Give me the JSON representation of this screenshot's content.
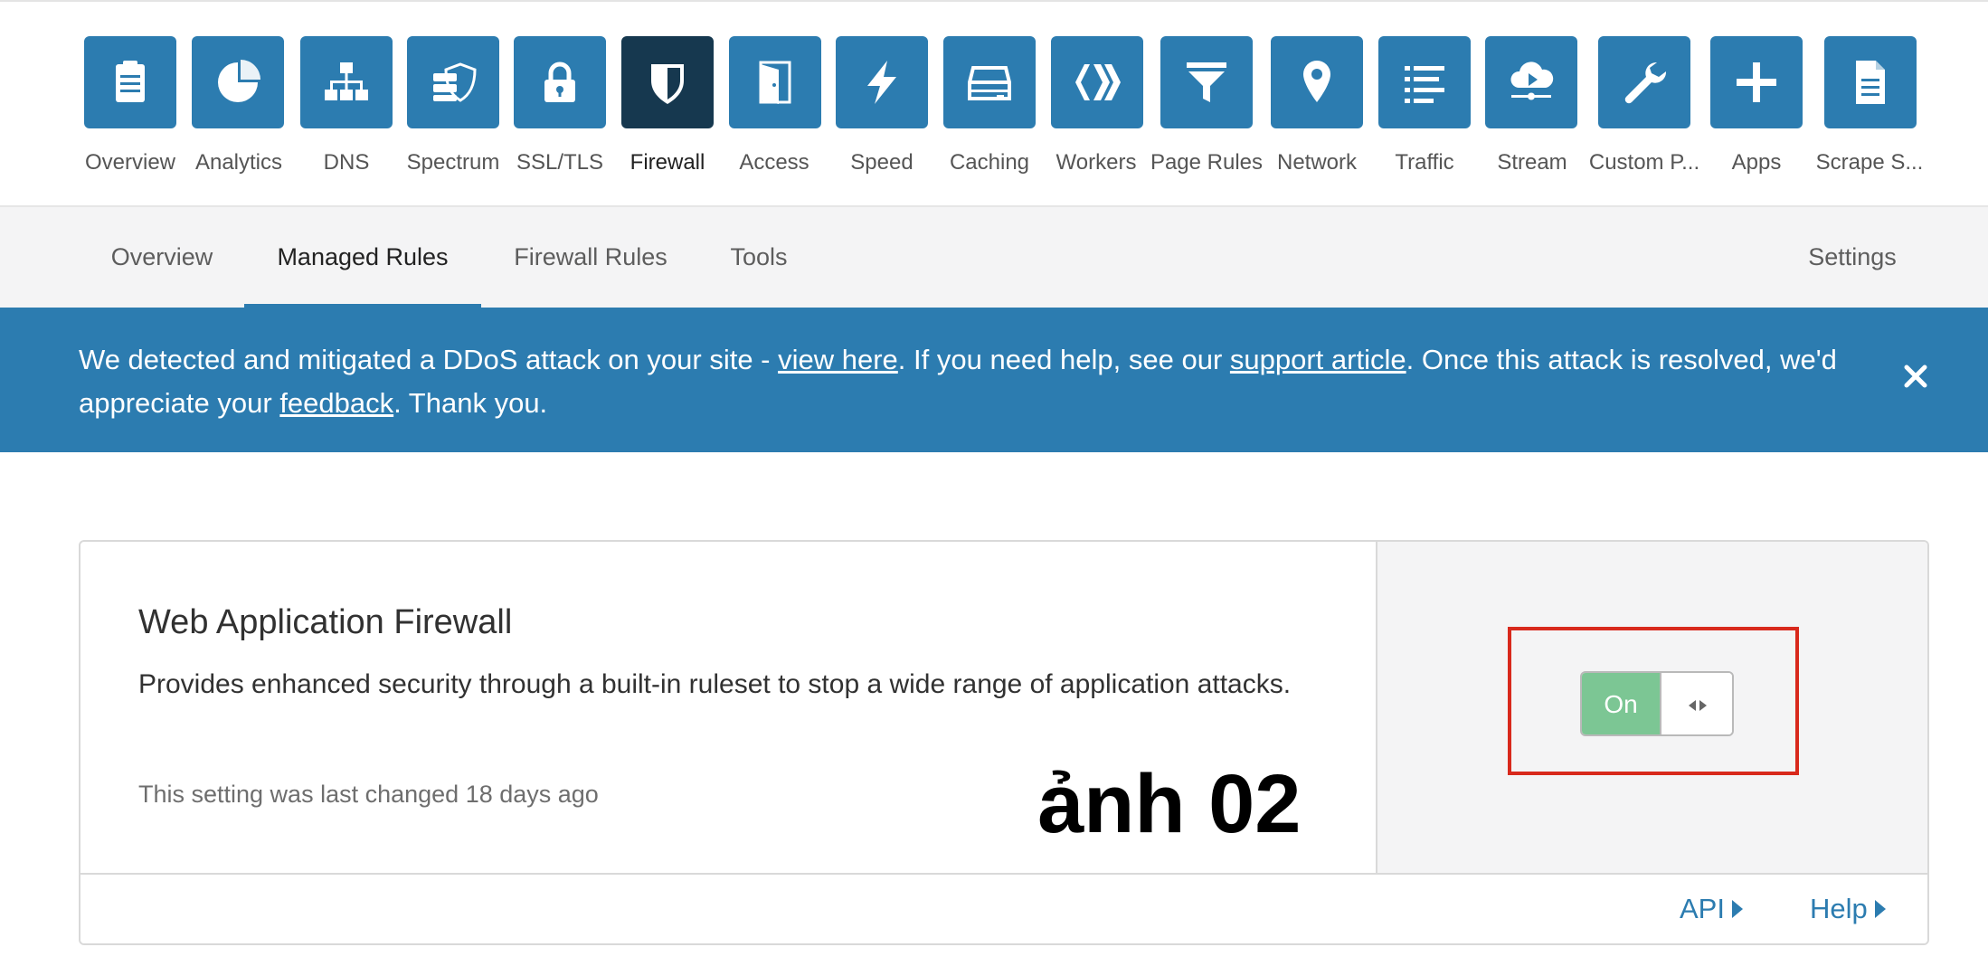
{
  "top_nav": {
    "items": [
      {
        "label": "Overview",
        "icon": "clipboard-icon"
      },
      {
        "label": "Analytics",
        "icon": "pie-chart-icon"
      },
      {
        "label": "DNS",
        "icon": "network-tree-icon"
      },
      {
        "label": "Spectrum",
        "icon": "server-shield-icon"
      },
      {
        "label": "SSL/TLS",
        "icon": "lock-icon"
      },
      {
        "label": "Firewall",
        "icon": "shield-icon",
        "active": true
      },
      {
        "label": "Access",
        "icon": "door-icon"
      },
      {
        "label": "Speed",
        "icon": "lightning-icon"
      },
      {
        "label": "Caching",
        "icon": "storage-drive-icon"
      },
      {
        "label": "Workers",
        "icon": "workers-chevrons-icon"
      },
      {
        "label": "Page Rules",
        "icon": "filter-icon"
      },
      {
        "label": "Network",
        "icon": "location-pin-icon"
      },
      {
        "label": "Traffic",
        "icon": "list-icon"
      },
      {
        "label": "Stream",
        "icon": "cloud-play-icon"
      },
      {
        "label": "Custom P...",
        "icon": "wrench-icon"
      },
      {
        "label": "Apps",
        "icon": "plus-icon"
      },
      {
        "label": "Scrape S...",
        "icon": "document-icon"
      }
    ]
  },
  "sub_nav": {
    "tabs": [
      {
        "label": "Overview"
      },
      {
        "label": "Managed Rules",
        "active": true
      },
      {
        "label": "Firewall Rules"
      },
      {
        "label": "Tools"
      }
    ],
    "settings_label": "Settings"
  },
  "banner": {
    "text_1": "We detected and mitigated a DDoS attack on your site - ",
    "link_view_here": "view here",
    "text_2": ". If you need help, see our ",
    "link_support": "support article",
    "text_3": ". Once this attack is resolved, we'd appreciate your ",
    "link_feedback": "feedback",
    "text_4": ". Thank you.",
    "close_icon": "close-icon"
  },
  "waf_card": {
    "title": "Web Application Firewall",
    "description": "Provides enhanced security through a built-in ruleset to stop a wide range of application attacks.",
    "last_changed": "This setting was last changed 18 days ago",
    "stamp": "ảnh 02",
    "toggle": {
      "state_label": "On",
      "state": "on"
    },
    "footer": {
      "api_label": "API",
      "help_label": "Help"
    }
  },
  "colors": {
    "brand_blue": "#2c7cb0",
    "active_tile": "#16384f",
    "toggle_on_green": "#7cc694",
    "highlight_red": "#d8291c"
  }
}
